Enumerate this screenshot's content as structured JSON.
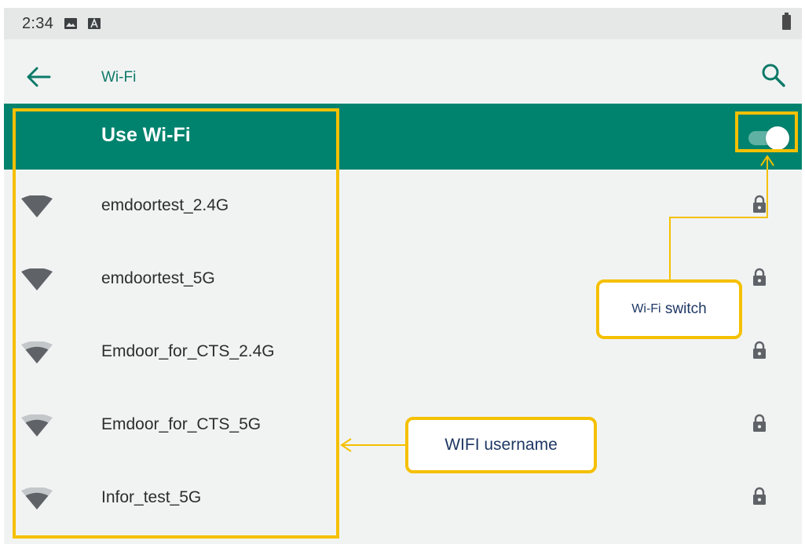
{
  "status_bar": {
    "time": "2:34",
    "icons": [
      "image-icon",
      "a-notification-icon"
    ],
    "battery_icon": "battery-icon"
  },
  "app_bar": {
    "back_icon": "arrow-back-icon",
    "title": "Wi-Fi",
    "search_icon": "search-icon"
  },
  "master_switch": {
    "label": "Use Wi-Fi",
    "enabled": true
  },
  "networks": [
    {
      "ssid": "emdoortest_2.4G",
      "signal": 4,
      "secured": true
    },
    {
      "ssid": "emdoortest_5G",
      "signal": 4,
      "secured": true
    },
    {
      "ssid": "Emdoor_for_CTS_2.4G",
      "signal": 3,
      "secured": true
    },
    {
      "ssid": "Emdoor_for_CTS_5G",
      "signal": 3,
      "secured": true
    },
    {
      "ssid": "Infor_test_5G",
      "signal": 3,
      "secured": true
    }
  ],
  "annotations": {
    "switch_callout_prefix": "Wi-Fi",
    "switch_callout_suffix": " switch",
    "username_callout": "WIFI username"
  },
  "colors": {
    "accent": "#00836e",
    "title": "#0d7a68",
    "annotation": "#f5c000",
    "annotation_text": "#1f3864"
  }
}
